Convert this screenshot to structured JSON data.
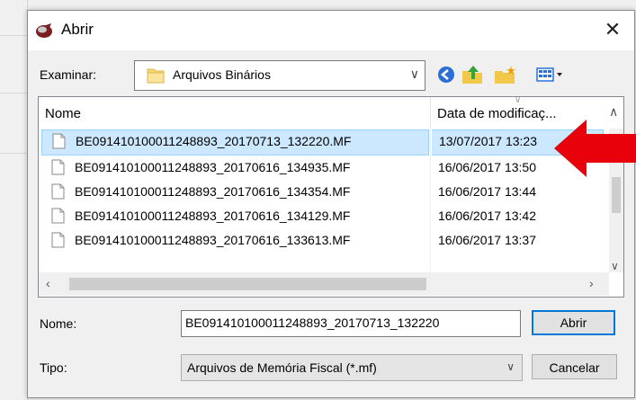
{
  "dialog": {
    "title": "Abrir",
    "close_symbol": "✕"
  },
  "look_in": {
    "label": "Examinar:",
    "folder": "Arquivos Binários"
  },
  "file_list": {
    "columns": {
      "name": "Nome",
      "date": "Data de modificaç..."
    },
    "rows": [
      {
        "name": "BE091410100011248893_20170713_132220.MF",
        "date": "13/07/2017 13:23",
        "selected": true
      },
      {
        "name": "BE091410100011248893_20170616_134935.MF",
        "date": "16/06/2017 13:50",
        "selected": false
      },
      {
        "name": "BE091410100011248893_20170616_134354.MF",
        "date": "16/06/2017 13:44",
        "selected": false
      },
      {
        "name": "BE091410100011248893_20170616_134129.MF",
        "date": "16/06/2017 13:42",
        "selected": false
      },
      {
        "name": "BE091410100011248893_20170616_133613.MF",
        "date": "16/06/2017 13:37",
        "selected": false
      }
    ]
  },
  "file_name": {
    "label": "Nome:",
    "value": "BE091410100011248893_20170713_132220"
  },
  "file_type": {
    "label": "Tipo:",
    "value": "Arquivos de Memória Fiscal (*.mf)"
  },
  "buttons": {
    "open": "Abrir",
    "cancel": "Cancelar"
  },
  "colors": {
    "selection": "#cce8ff",
    "selection_border": "#99d1ff",
    "accent": "#0078d7",
    "annotation_arrow": "#e8000b"
  },
  "icons": [
    "app-icon",
    "folder-icon",
    "back-icon",
    "up-folder-icon",
    "new-folder-icon",
    "view-menu-icon",
    "file-icon",
    "red-arrow-annotation"
  ]
}
